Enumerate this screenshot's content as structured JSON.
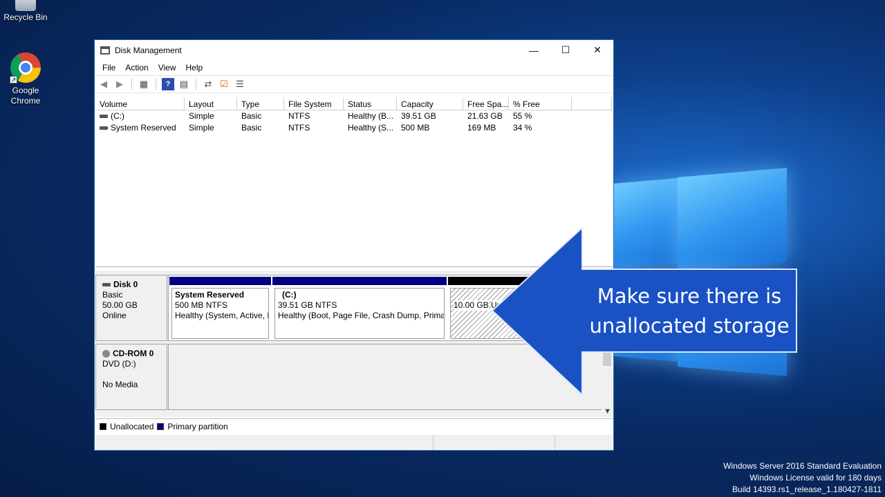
{
  "desktop": {
    "icons": [
      {
        "label": "Recycle Bin"
      },
      {
        "label": "Google Chrome"
      }
    ],
    "watermark": {
      "line1": "Windows Server 2016 Standard Evaluation",
      "line2": "Windows License valid for 180 days",
      "line3": "Build 14393.rs1_release_1.180427-1811"
    }
  },
  "window": {
    "title": "Disk Management",
    "controls": {
      "minimize": "—",
      "maximize": "☐",
      "close": "✕"
    },
    "menu": [
      "File",
      "Action",
      "View",
      "Help"
    ],
    "toolbar_icons": [
      "back-icon",
      "forward-icon",
      "properties-icon",
      "help-icon",
      "console-icon",
      "refresh-icon",
      "check-icon",
      "list-icon"
    ]
  },
  "volumes": {
    "columns": [
      "Volume",
      "Layout",
      "Type",
      "File System",
      "Status",
      "Capacity",
      "Free Spa...",
      "% Free",
      ""
    ],
    "rows": [
      [
        "(C:)",
        "Simple",
        "Basic",
        "NTFS",
        "Healthy (B...",
        "39.51 GB",
        "21.63 GB",
        "55 %"
      ],
      [
        "System Reserved",
        "Simple",
        "Basic",
        "NTFS",
        "Healthy (S...",
        "500 MB",
        "169 MB",
        "34 %"
      ]
    ]
  },
  "disks": {
    "disk0": {
      "name": "Disk 0",
      "type": "Basic",
      "size": "50.00 GB",
      "state": "Online",
      "partitions": [
        {
          "name": "System Reserved",
          "size": "500 MB NTFS",
          "status": "Healthy (System, Active, P"
        },
        {
          "name": "(C:)",
          "size": "39.51 GB NTFS",
          "status": "Healthy (Boot, Page File, Crash Dump, Primar"
        },
        {
          "size": "10.00 GB",
          "status": "Unallocated"
        }
      ]
    },
    "cdrom0": {
      "name": "CD-ROM 0",
      "type": "DVD (D:)",
      "state": "No Media"
    }
  },
  "legend": {
    "unallocated": "Unallocated",
    "primary": "Primary partition"
  },
  "colors": {
    "primary_partition": "#000080",
    "unallocated": "#000000",
    "callout": "#1a52c4"
  },
  "callout": {
    "line1": "Make sure there is",
    "line2": "unallocated storage"
  }
}
